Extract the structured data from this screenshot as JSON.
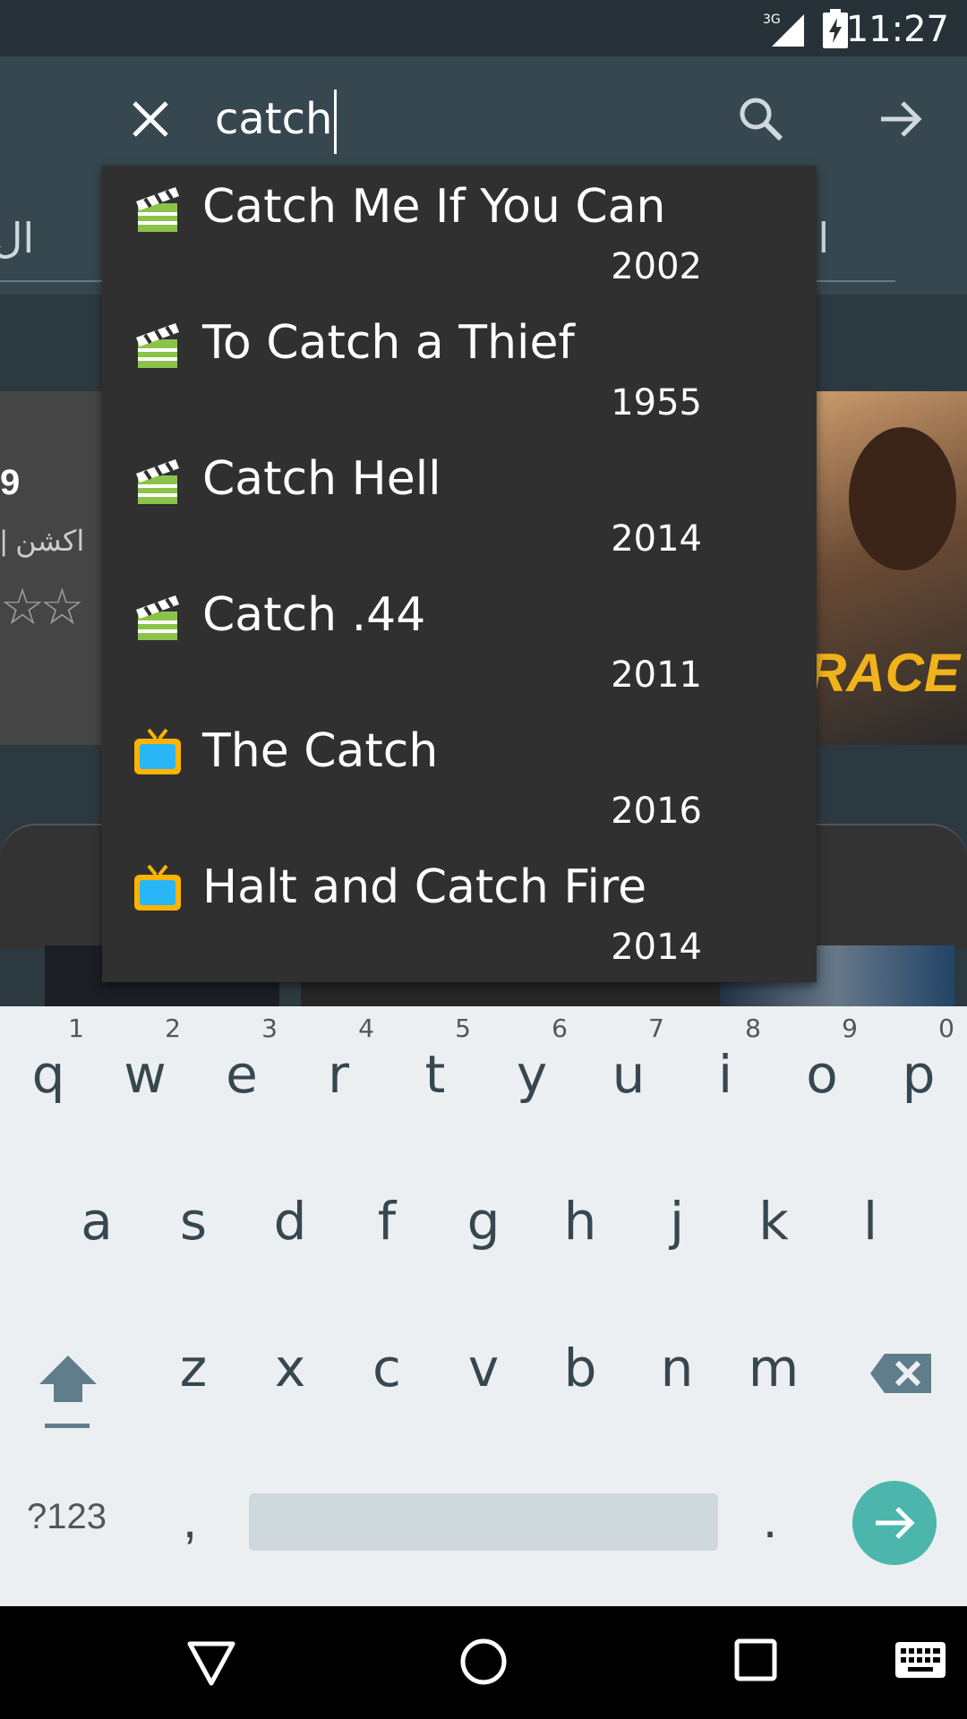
{
  "status_bar": {
    "network": "3G",
    "time": "11:27"
  },
  "search": {
    "query": "catch"
  },
  "background": {
    "tab_left": "ال",
    "tab_right": "ال",
    "rating": "9",
    "genre": "| اكشن",
    "poster_title": "RACE"
  },
  "suggestions": [
    {
      "icon": "movie-clapper-icon",
      "title": "Catch Me If You Can",
      "year": "2002"
    },
    {
      "icon": "movie-clapper-icon",
      "title": "To Catch a Thief",
      "year": "1955"
    },
    {
      "icon": "movie-clapper-icon",
      "title": "Catch Hell",
      "year": "2014"
    },
    {
      "icon": "movie-clapper-icon",
      "title": "Catch .44",
      "year": "2011"
    },
    {
      "icon": "tv-icon",
      "title": "The Catch",
      "year": "2016"
    },
    {
      "icon": "tv-icon",
      "title": "Halt and Catch Fire",
      "year": "2014"
    }
  ],
  "keyboard": {
    "row1": [
      {
        "key": "q",
        "hint": "1"
      },
      {
        "key": "w",
        "hint": "2"
      },
      {
        "key": "e",
        "hint": "3"
      },
      {
        "key": "r",
        "hint": "4"
      },
      {
        "key": "t",
        "hint": "5"
      },
      {
        "key": "y",
        "hint": "6"
      },
      {
        "key": "u",
        "hint": "7"
      },
      {
        "key": "i",
        "hint": "8"
      },
      {
        "key": "o",
        "hint": "9"
      },
      {
        "key": "p",
        "hint": "0"
      }
    ],
    "row2": [
      "a",
      "s",
      "d",
      "f",
      "g",
      "h",
      "j",
      "k",
      "l"
    ],
    "row3": [
      "z",
      "x",
      "c",
      "v",
      "b",
      "n",
      "m"
    ],
    "symbols_label": "?123",
    "comma_label": ",",
    "period_label": "."
  },
  "colors": {
    "toolbar": "#37474f",
    "dropdown": "#303030",
    "keyboard": "#eceff1",
    "enter_key": "#4db6ac",
    "movie_icon": "#8bc34a",
    "tv_icon": "#29b6f6"
  }
}
